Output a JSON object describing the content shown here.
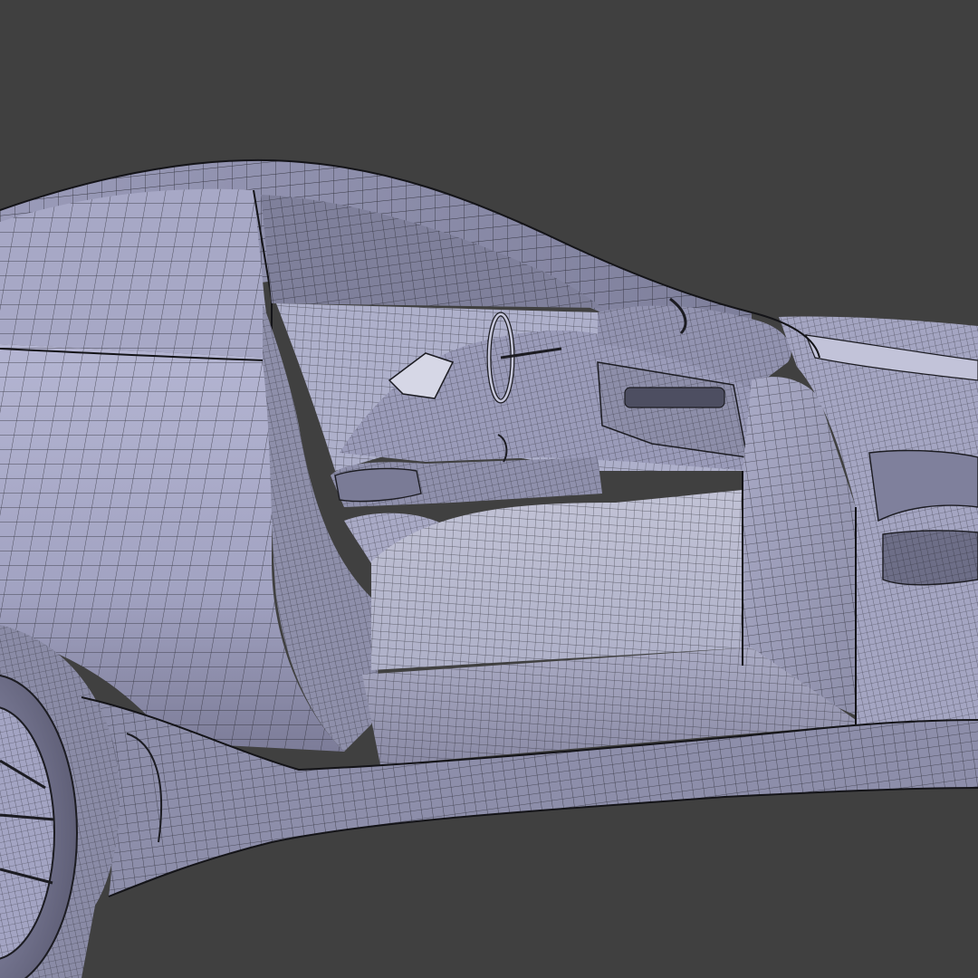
{
  "viewport": {
    "background_color": "#404040",
    "mesh_fill_light": "#b9bad6",
    "mesh_fill_mid": "#9c9cbd",
    "mesh_fill_dark": "#6e6e88",
    "wire_color": "#1c1c22"
  }
}
